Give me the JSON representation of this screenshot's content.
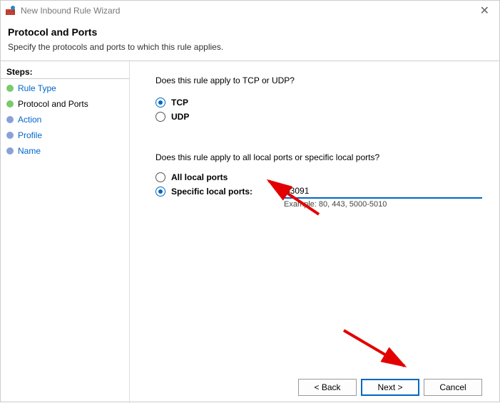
{
  "window": {
    "title": "New Inbound Rule Wizard"
  },
  "header": {
    "title": "Protocol and Ports",
    "subtitle": "Specify the protocols and ports to which this rule applies."
  },
  "sidebar": {
    "heading": "Steps:",
    "items": [
      {
        "label": "Rule Type"
      },
      {
        "label": "Protocol and Ports"
      },
      {
        "label": "Action"
      },
      {
        "label": "Profile"
      },
      {
        "label": "Name"
      }
    ]
  },
  "content": {
    "prompt1": "Does this rule apply to TCP or UDP?",
    "tcp_label": "TCP",
    "udp_label": "UDP",
    "prompt2": "Does this rule apply to all local ports or specific local ports?",
    "all_ports_label": "All local ports",
    "specific_ports_label": "Specific local ports:",
    "port_value": "33091",
    "example": "Example: 80, 443, 5000-5010"
  },
  "buttons": {
    "back": "< Back",
    "next": "Next >",
    "cancel": "Cancel"
  }
}
